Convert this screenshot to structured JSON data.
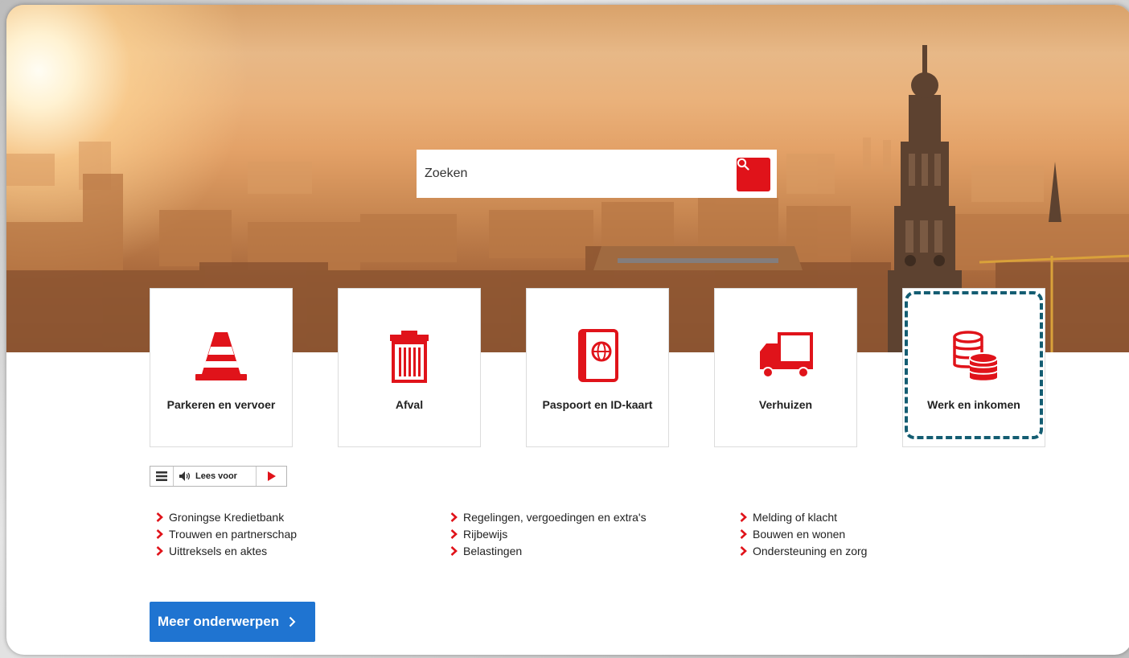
{
  "search": {
    "placeholder": "Zoeken"
  },
  "tiles": [
    {
      "label": "Parkeren en vervoer",
      "icon": "traffic-cone-icon"
    },
    {
      "label": "Afval",
      "icon": "trash-can-icon"
    },
    {
      "label": "Paspoort en ID-kaart",
      "icon": "passport-icon"
    },
    {
      "label": "Verhuizen",
      "icon": "moving-truck-icon"
    },
    {
      "label": "Werk en inkomen",
      "icon": "coins-icon"
    }
  ],
  "readspeaker": {
    "label": "Lees voor"
  },
  "links": {
    "col1": [
      "Groningse Kredietbank",
      "Trouwen en partnerschap",
      "Uittreksels en aktes"
    ],
    "col2": [
      "Regelingen, vergoedingen en extra's",
      "Rijbewijs",
      "Belastingen"
    ],
    "col3": [
      "Melding of klacht",
      "Bouwen en wonen",
      "Ondersteuning en zorg"
    ]
  },
  "more_button": {
    "label": "Meer onderwerpen"
  },
  "colors": {
    "accent_red": "#e0131a",
    "button_blue": "#1f74d1",
    "highlight": "#145d72"
  }
}
